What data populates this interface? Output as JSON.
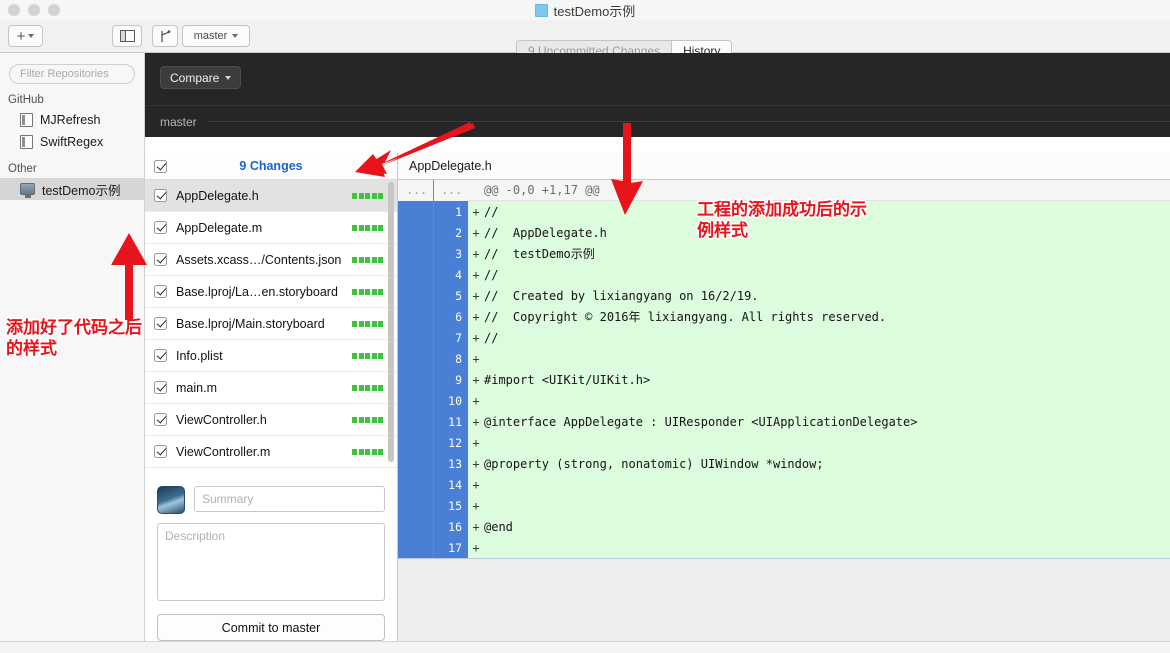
{
  "window": {
    "title": "testDemo示例",
    "project_icon": "project-icon"
  },
  "toolbar": {
    "add_label": "+",
    "sidebar_toggle": "sidebar-toggle-icon",
    "branch_icon": "branch-icon",
    "branch_name": "master",
    "segments": [
      {
        "label": "9 Uncommitted Changes",
        "active": false
      },
      {
        "label": "History",
        "active": true
      }
    ]
  },
  "sidebar": {
    "filter_placeholder": "Filter Repositories",
    "sections": [
      {
        "label": "GitHub",
        "items": [
          {
            "label": "MJRefresh",
            "icon": "repo-book-icon",
            "selected": false
          },
          {
            "label": "SwiftRegex",
            "icon": "repo-book-icon",
            "selected": false
          }
        ]
      },
      {
        "label": "Other",
        "items": [
          {
            "label": "testDemo示例",
            "icon": "repo-monitor-icon",
            "selected": true
          }
        ]
      }
    ]
  },
  "dark_bar": {
    "compare_label": "Compare",
    "branch_label": "master"
  },
  "changes": {
    "header_title": "9 Changes",
    "header_checked": true,
    "files": [
      {
        "name": "AppDelegate.h",
        "checked": true,
        "selected": true,
        "bars": 5
      },
      {
        "name": "AppDelegate.m",
        "checked": true,
        "selected": false,
        "bars": 5
      },
      {
        "name": "Assets.xcass…/Contents.json",
        "checked": true,
        "selected": false,
        "bars": 5
      },
      {
        "name": "Base.lproj/La…en.storyboard",
        "checked": true,
        "selected": false,
        "bars": 5
      },
      {
        "name": "Base.lproj/Main.storyboard",
        "checked": true,
        "selected": false,
        "bars": 5
      },
      {
        "name": "Info.plist",
        "checked": true,
        "selected": false,
        "bars": 5
      },
      {
        "name": "main.m",
        "checked": true,
        "selected": false,
        "bars": 5
      },
      {
        "name": "ViewController.h",
        "checked": true,
        "selected": false,
        "bars": 5
      },
      {
        "name": "ViewController.m",
        "checked": true,
        "selected": false,
        "bars": 5
      }
    ],
    "summary_placeholder": "Summary",
    "description_placeholder": "Description",
    "commit_button": "Commit to master"
  },
  "diff": {
    "filename": "AppDelegate.h",
    "hunk_header": "@@ -0,0 +1,17 @@",
    "hunk_gutter_old": "...",
    "hunk_gutter_new": "...",
    "lines": [
      {
        "num": "1",
        "sign": "+",
        "text": "//"
      },
      {
        "num": "2",
        "sign": "+",
        "text": "//  AppDelegate.h"
      },
      {
        "num": "3",
        "sign": "+",
        "text": "//  testDemo示例"
      },
      {
        "num": "4",
        "sign": "+",
        "text": "//"
      },
      {
        "num": "5",
        "sign": "+",
        "text": "//  Created by lixiangyang on 16/2/19."
      },
      {
        "num": "6",
        "sign": "+",
        "text": "//  Copyright © 2016年 lixiangyang. All rights reserved."
      },
      {
        "num": "7",
        "sign": "+",
        "text": "//"
      },
      {
        "num": "8",
        "sign": "+",
        "text": ""
      },
      {
        "num": "9",
        "sign": "+",
        "text": "#import <UIKit/UIKit.h>"
      },
      {
        "num": "10",
        "sign": "+",
        "text": ""
      },
      {
        "num": "11",
        "sign": "+",
        "text": "@interface AppDelegate : UIResponder <UIApplicationDelegate>"
      },
      {
        "num": "12",
        "sign": "+",
        "text": ""
      },
      {
        "num": "13",
        "sign": "+",
        "text": "@property (strong, nonatomic) UIWindow *window;"
      },
      {
        "num": "14",
        "sign": "+",
        "text": ""
      },
      {
        "num": "15",
        "sign": "+",
        "text": ""
      },
      {
        "num": "16",
        "sign": "+",
        "text": "@end"
      },
      {
        "num": "17",
        "sign": "+",
        "text": ""
      }
    ]
  },
  "annotations": {
    "left": "添加好了代码之后的样式",
    "right": "工程的添加成功后的示例样式"
  },
  "colors": {
    "accent_blue": "#1964c8",
    "gutter_blue": "#4a7fd6",
    "diff_add_green": "#ddfbdd",
    "annotation_red": "#e8141b",
    "dark_bar": "#262626"
  }
}
